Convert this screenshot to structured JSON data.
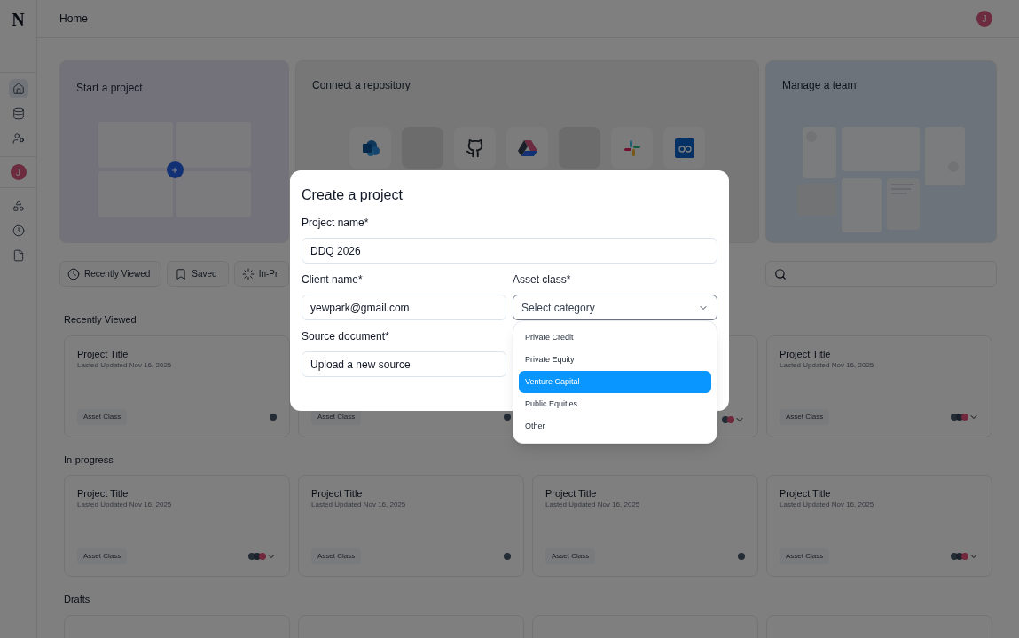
{
  "logo": "N",
  "header": {
    "title": "Home",
    "avatar": "J"
  },
  "sidebar": {
    "items": [
      {
        "kind": "home",
        "selected": true
      },
      {
        "kind": "database",
        "selected": false
      },
      {
        "kind": "users",
        "selected": false
      },
      {
        "kind": "avatar",
        "label": "J",
        "selected": false
      },
      {
        "kind": "shapes",
        "selected": false
      },
      {
        "kind": "clock",
        "selected": false
      },
      {
        "kind": "file",
        "selected": false
      }
    ]
  },
  "hero_cards": [
    {
      "kind": "start",
      "title": "Start a project"
    },
    {
      "kind": "connect",
      "title": "Connect a repository"
    },
    {
      "kind": "team",
      "title": "Manage a team"
    }
  ],
  "filters": [
    {
      "kind": "clock",
      "label": "Recently Viewed"
    },
    {
      "kind": "bookmark",
      "label": "Saved"
    },
    {
      "kind": "loader",
      "label": "In-Pr"
    }
  ],
  "sections": [
    {
      "title": "Recently Viewed",
      "cards": [
        {
          "kind": "project",
          "title": "Project Title",
          "subtitle": "Lasted Updated Nov 16, 2025",
          "tag": "Asset Class",
          "avatars": [
            {
              "color": "#232b35"
            }
          ],
          "expandable": false
        },
        {
          "kind": "project",
          "tag": "Asset Class",
          "avatars": [
            {
              "color": "#232b35"
            }
          ],
          "expandable": false
        },
        {
          "kind": "project",
          "avatars": [
            {
              "color": "#232b35"
            },
            {
              "color": "#70293d"
            }
          ],
          "expandable": true
        },
        {
          "kind": "project",
          "title": "Project Title",
          "subtitle": "Lasted Updated Nov 16, 2025",
          "tag": "Asset Class",
          "avatars": [
            {
              "color": "#232b35"
            },
            {
              "color": "#1a212b"
            },
            {
              "color": "#70293d"
            }
          ],
          "expandable": true
        }
      ]
    },
    {
      "title": "In-progress",
      "cards": [
        {
          "kind": "project",
          "title": "Project Title",
          "subtitle": "Lasted Updated Nov 16, 2025",
          "tag": "Asset Class",
          "avatars": [
            {
              "color": "#232b35"
            },
            {
              "color": "#1a212b"
            },
            {
              "color": "#70293d"
            }
          ],
          "expandable": true
        },
        {
          "kind": "project",
          "title": "Project Title",
          "subtitle": "Lasted Updated Nov 16, 2025",
          "tag": "Asset Class",
          "avatars": [
            {
              "color": "#232b35"
            }
          ],
          "expandable": false
        },
        {
          "kind": "project",
          "title": "Project Title",
          "subtitle": "Lasted Updated Nov 16, 2025",
          "tag": "Asset Class",
          "avatars": [
            {
              "color": "#232b35"
            }
          ],
          "expandable": false
        },
        {
          "kind": "project",
          "title": "Project Title",
          "subtitle": "Lasted Updated Nov 16, 2025",
          "tag": "Asset Class",
          "avatars": [
            {
              "color": "#232b35"
            },
            {
              "color": "#1a212b"
            },
            {
              "color": "#70293d"
            }
          ],
          "expandable": true
        }
      ]
    },
    {
      "title": "Drafts",
      "cards": [
        {
          "kind": "blank"
        },
        {
          "kind": "blank"
        },
        {
          "kind": "blank"
        },
        {
          "kind": "blank"
        }
      ]
    }
  ],
  "modal": {
    "title": "Create a project",
    "project_name": {
      "label": "Project name*",
      "value": "DDQ 2026"
    },
    "client_name": {
      "label": "Client name*",
      "value": "yewpark@gmail.com"
    },
    "asset_class": {
      "label": "Asset class*",
      "placeholder": "Select category",
      "expanded": true,
      "options": [
        {
          "label": "Private Credit",
          "selected": false
        },
        {
          "label": "Private Equity",
          "selected": false
        },
        {
          "label": "Venture Capital",
          "selected": true
        },
        {
          "label": "Public Equities",
          "selected": false
        },
        {
          "label": "Other",
          "selected": false
        }
      ]
    },
    "source_document": {
      "label": "Source document*",
      "value": "Upload a new source"
    }
  }
}
